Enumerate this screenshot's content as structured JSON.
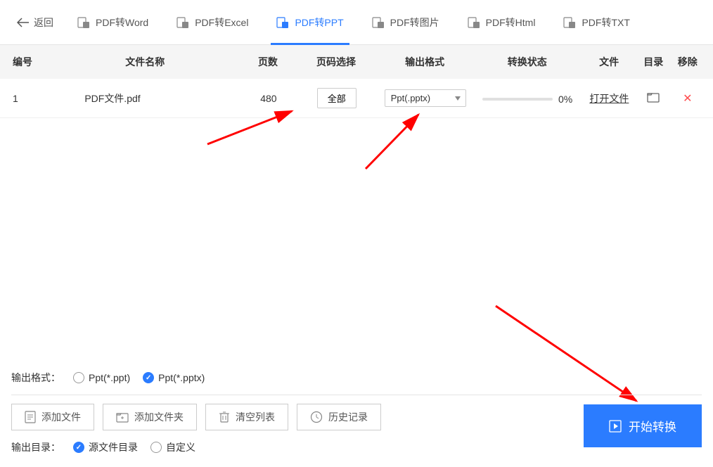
{
  "back_label": "返回",
  "tabs": [
    {
      "label": "PDF转Word"
    },
    {
      "label": "PDF转Excel"
    },
    {
      "label": "PDF转PPT"
    },
    {
      "label": "PDF转图片"
    },
    {
      "label": "PDF转Html"
    },
    {
      "label": "PDF转TXT"
    }
  ],
  "active_tab_index": 2,
  "headers": {
    "num": "编号",
    "name": "文件名称",
    "pages": "页数",
    "range": "页码选择",
    "format": "输出格式",
    "status": "转换状态",
    "file": "文件",
    "dir": "目录",
    "remove": "移除"
  },
  "rows": [
    {
      "num": "1",
      "name": "PDF文件.pdf",
      "pages": "480",
      "range_btn": "全部",
      "format_sel": "Ppt(.pptx)",
      "progress_pct": "0%",
      "file_link": "打开文件"
    }
  ],
  "output_format": {
    "label": "输出格式：",
    "options": [
      {
        "label": "Ppt(*.ppt)",
        "checked": false
      },
      {
        "label": "Ppt(*.pptx)",
        "checked": true
      }
    ]
  },
  "actions": {
    "add_file": "添加文件",
    "add_folder": "添加文件夹",
    "clear_list": "清空列表",
    "history": "历史记录"
  },
  "output_dir": {
    "label": "输出目录：",
    "options": [
      {
        "label": "源文件目录",
        "checked": true
      },
      {
        "label": "自定义",
        "checked": false
      }
    ]
  },
  "convert_label": "开始转换"
}
